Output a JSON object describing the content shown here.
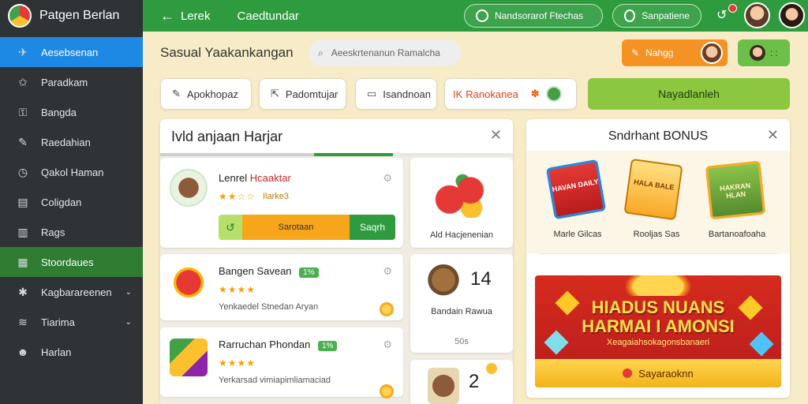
{
  "app": {
    "title": "Patgen Berlan"
  },
  "sidebar": {
    "items": [
      {
        "label": "Aesebsenan",
        "icon": "rocket-icon",
        "glyph": "✈"
      },
      {
        "label": "Paradkam",
        "icon": "star-icon",
        "glyph": "✩"
      },
      {
        "label": "Bangda",
        "icon": "lock-icon",
        "glyph": "⚿"
      },
      {
        "label": "Raedahian",
        "icon": "wrench-icon",
        "glyph": "✎"
      },
      {
        "label": "Qakol Haman",
        "icon": "clock-icon",
        "glyph": "◷"
      },
      {
        "label": "Coligdan",
        "icon": "document-icon",
        "glyph": "▤"
      },
      {
        "label": "Rags",
        "icon": "chart-icon",
        "glyph": "▥"
      },
      {
        "label": "Stoordaues",
        "icon": "grid-icon",
        "glyph": "▦"
      },
      {
        "label": "Kagbarareenen",
        "icon": "puzzle-icon",
        "glyph": "✱"
      },
      {
        "label": "Tiarima",
        "icon": "wifi-icon",
        "glyph": "≋"
      },
      {
        "label": "Harlan",
        "icon": "user-icon",
        "glyph": "☻"
      }
    ]
  },
  "topbar": {
    "back_label": "Lerek",
    "title": "Caedtundar",
    "search_btn": "Nandsorarof Ftechas",
    "help_btn": "Sanpatiene"
  },
  "toolbar": {
    "section_title": "Sasual Yaakankangan",
    "search_placeholder": "Aeeskrtenanun Ramalcha",
    "orange_label": "Nahgg",
    "green_label": ": :"
  },
  "chips": [
    {
      "label": "Apokhopaz",
      "icon": "edit-icon",
      "glyph": "✎"
    },
    {
      "label": "Padomtujar",
      "icon": "share-icon",
      "glyph": "⇱"
    },
    {
      "label": "Isandnoan",
      "icon": "folder-icon",
      "glyph": "▭"
    },
    {
      "label": "Ranokanea",
      "prefix": "IK",
      "icon": "star-icon",
      "glyph": "✽"
    }
  ],
  "cta": {
    "label": "Nayadlanleh"
  },
  "quest_panel": {
    "title": "Ivld anjaan Harjar",
    "cards": [
      {
        "name": "Lenrel",
        "name_red": "Hcaaktar",
        "stars": "★★☆☆",
        "sub": "Ilarke3",
        "progress_label": "Sarotaan",
        "action": "Saqrh"
      },
      {
        "name": "Bangen Savean",
        "tag": "1%",
        "stars": "★★★★",
        "sub": "Yenkaedel Stnedan Aryan"
      },
      {
        "name": "Rarruchan Phondan",
        "tag": "1%",
        "stars": "★★★★",
        "sub": "Yerkarsad vimiapimliamaciad"
      }
    ],
    "rewards": [
      {
        "label": "Ald Hacjenenian"
      },
      {
        "num": "14",
        "label": "Bandain Rawua",
        "small": "50s"
      },
      {
        "num": "2"
      }
    ]
  },
  "bonus_panel": {
    "title": "Sndrhant BONUS",
    "items": [
      {
        "label": "Marle Gilcas",
        "card_text": "HAVAN DAILY"
      },
      {
        "label": "Rooljas Sas",
        "card_text": "HALA BALE"
      },
      {
        "label": "Bartanoafoaha",
        "card_text": "HAKRAN HLAN"
      }
    ],
    "banner": {
      "line1": "HIADUS NUANS",
      "line2": "HARMAI I AMONSI",
      "line3": "Xeagaiahsokagonsbanaeri",
      "button": "Sayaraoknn"
    }
  },
  "colors": {
    "green": "#2e9c3e",
    "sidebar": "#2f3336",
    "accent_blue": "#1e88e5",
    "orange": "#f59224"
  }
}
